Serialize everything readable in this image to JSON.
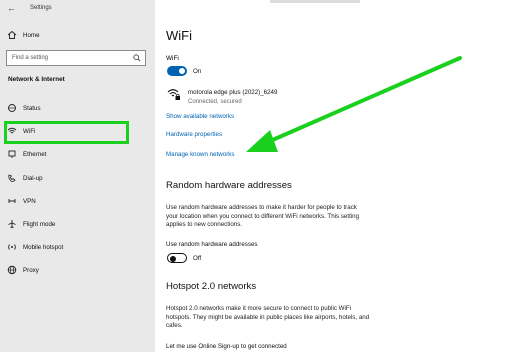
{
  "window": {
    "title": "Settings"
  },
  "sidebar": {
    "home_label": "Home",
    "search_placeholder": "Find a setting",
    "section_title": "Network & Internet",
    "items": [
      {
        "label": "Status",
        "icon": "status-icon"
      },
      {
        "label": "WiFi",
        "icon": "wifi-icon"
      },
      {
        "label": "Ethernet",
        "icon": "ethernet-icon"
      },
      {
        "label": "Dial-up",
        "icon": "dialup-icon"
      },
      {
        "label": "VPN",
        "icon": "vpn-icon"
      },
      {
        "label": "Flight mode",
        "icon": "airplane-icon"
      },
      {
        "label": "Mobile hotspot",
        "icon": "hotspot-icon"
      },
      {
        "label": "Proxy",
        "icon": "globe-icon"
      }
    ],
    "selected": "WiFi"
  },
  "main": {
    "title": "WiFi",
    "wifi_label": "WiFi",
    "wifi_toggle_state": "On",
    "network": {
      "name": "motorola edge plus (2022)_6249",
      "status": "Connected, secured"
    },
    "links": {
      "show_available": "Show available networks",
      "hardware": "Hardware properties",
      "manage_known": "Manage known networks"
    },
    "random_hw": {
      "heading": "Random hardware addresses",
      "description": "Use random hardware addresses to make it harder for people to track your location when you connect to different WiFi networks. This setting applies to new connections.",
      "toggle_label": "Use random hardware addresses",
      "toggle_state": "Off"
    },
    "hotspot20": {
      "heading": "Hotspot 2.0 networks",
      "description": "Hotspot 2.0 networks make it more secure to connect to public WiFi hotspots. They might be available in public places like airports, hotels, and cafes.",
      "signup_label": "Let me use Online Sign-up to get connected"
    }
  },
  "colors": {
    "accent": "#0063b1",
    "highlight": "#19d11d",
    "sidebar_bg": "#e9e9e9"
  }
}
